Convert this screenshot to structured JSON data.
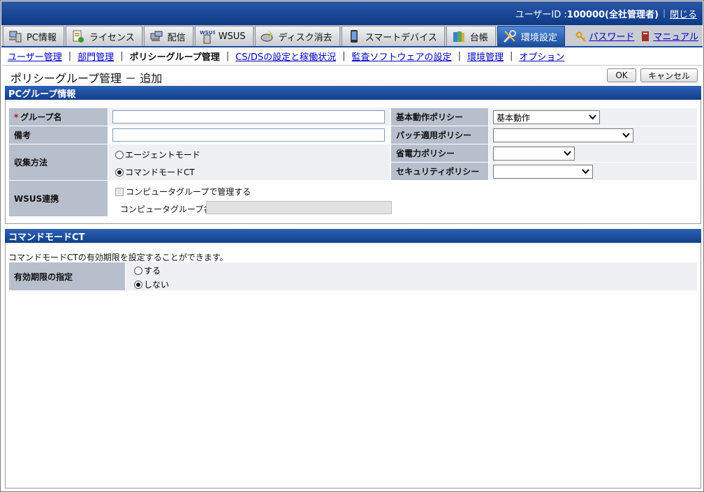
{
  "topbar": {
    "user_label": "ユーザーID : ",
    "user_value": "100000(全社管理者)",
    "logout": "閉じる"
  },
  "tabs": [
    {
      "label": "PC情報",
      "icon": "pc-icon"
    },
    {
      "label": "ライセンス",
      "icon": "license-icon"
    },
    {
      "label": "配信",
      "icon": "delivery-icon"
    },
    {
      "label": "WSUS",
      "icon": "wsus-icon"
    },
    {
      "label": "ディスク消去",
      "icon": "disk-erase-icon"
    },
    {
      "label": "スマートデバイス",
      "icon": "smart-device-icon"
    },
    {
      "label": "台帳",
      "icon": "ledger-icon"
    },
    {
      "label": "環境設定",
      "icon": "settings-icon"
    }
  ],
  "toplinks": {
    "password": "パスワード",
    "manual": "マニュアル"
  },
  "subnav": {
    "user_mgmt": "ユーザー管理",
    "dept_mgmt": "部門管理",
    "policy_group": "ポリシーグループ管理",
    "csds": "CS/DSの設定と稼働状況",
    "audit": "監査ソフトウェアの設定",
    "env": "環境管理",
    "option": "オプション"
  },
  "page": {
    "title": "ポリシーグループ管理 － 追加",
    "ok": "OK",
    "cancel": "キャンセル"
  },
  "pc_group": {
    "header": "PCグループ情報",
    "group_name_label": "グループ名",
    "required_mark": "*",
    "note_label": "備考",
    "collect_label": "収集方法",
    "agent_mode": "エージェントモード",
    "command_mode": "コマンドモードCT",
    "wsus_label": "WSUS連携",
    "wsus_checkbox": "コンピュータグループで管理する",
    "wsus_group_name": "コンピュータグループ名",
    "basic_policy_label": "基本動作ポリシー",
    "basic_policy_value": "基本動作",
    "patch_policy_label": "パッチ適用ポリシー",
    "patch_policy_value": "",
    "power_policy_label": "省電力ポリシー",
    "power_policy_value": "",
    "security_policy_label": "セキュリティポリシー",
    "security_policy_value": ""
  },
  "command_ct": {
    "header": "コマンドモードCT",
    "desc": "コマンドモードCTの有効期限を設定することができます。",
    "expiry_label": "有効期限の指定",
    "yes": "する",
    "no": "しない"
  },
  "colors": {
    "accent": "#1c4e9c",
    "label_bg": "#b7bfcc",
    "link": "#0000cc"
  }
}
